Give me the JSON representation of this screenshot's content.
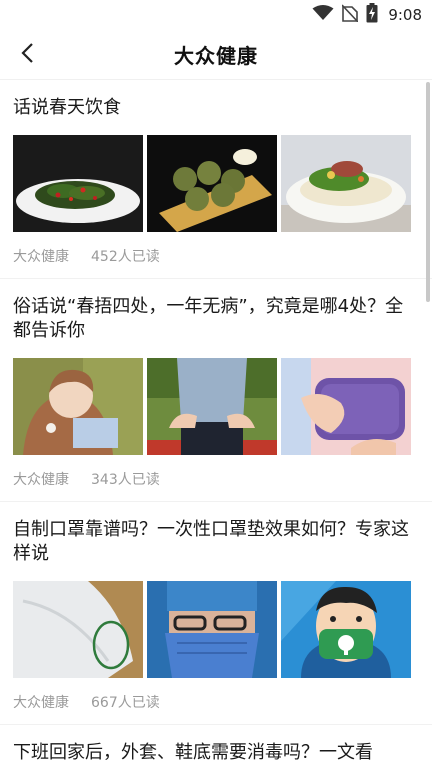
{
  "status_bar": {
    "time": "9:08",
    "icons": [
      "wifi-icon",
      "no-sim-icon",
      "battery-charging-icon"
    ]
  },
  "header": {
    "title": "大众健康",
    "back_icon": "chevron-left-icon"
  },
  "articles": [
    {
      "title": "话说春天饮食",
      "source": "大众健康",
      "reads": "452人已读",
      "images": [
        "stir-fried-greens-photo",
        "fried-patties-photo",
        "vegetable-soup-photo"
      ]
    },
    {
      "title": "俗话说“春捂四处，一年无病”，究竟是哪4处？全都告诉你",
      "source": "大众健康",
      "reads": "343人已读",
      "images": [
        "toddler-in-hoodie-photo",
        "person-back-pain-photo",
        "hot-water-bottle-photo"
      ]
    },
    {
      "title": "自制口罩靠谱吗？一次性口罩垫效果如何？专家这样说",
      "source": "大众健康",
      "reads": "667人已读",
      "images": [
        "mask-closeup-photo",
        "doctor-wearing-mask-photo",
        "mask-cartoon-photo"
      ]
    },
    {
      "title": "下班回家后，外套、鞋底需要消毒吗？一文看"
    }
  ]
}
